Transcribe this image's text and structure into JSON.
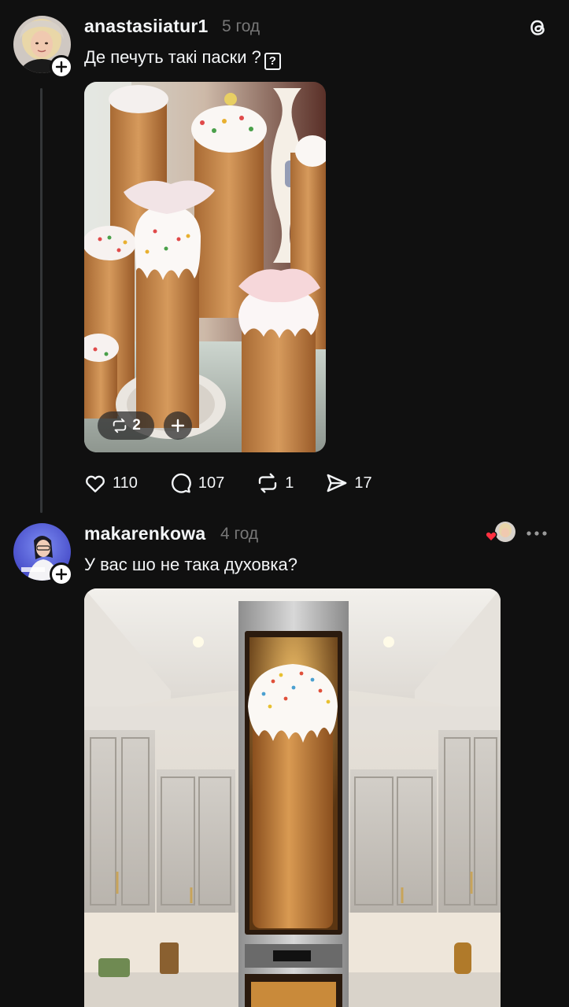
{
  "app": {
    "logo_icon": "threads-logo-icon"
  },
  "posts": [
    {
      "username": "anastasiiatur1",
      "time": "5 год",
      "text": "Де печуть такі паски ?",
      "text_emoji": "?",
      "media": {
        "description_icon": "photo-tall-paskas",
        "repost_count": "2"
      },
      "stats": {
        "likes": "110",
        "comments": "107",
        "reposts": "1",
        "shares": "17"
      }
    },
    {
      "username": "makarenkowa",
      "time": "4 год",
      "text": "У вас шо не така духовка?",
      "liked_by_author": true,
      "media": {
        "description_icon": "photo-oven-paska"
      }
    }
  ],
  "colors": {
    "background": "#101010",
    "text": "#f3f5f7",
    "muted": "#777777",
    "heart": "#ff3040"
  }
}
